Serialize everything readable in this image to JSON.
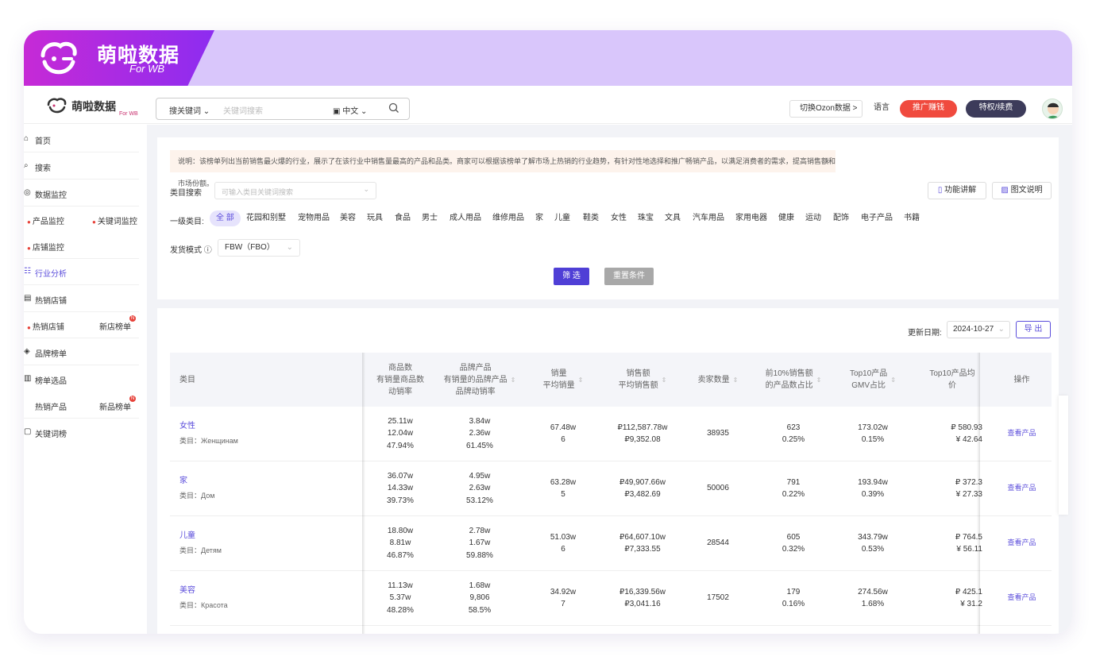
{
  "banner": {
    "brand": "萌啦数据",
    "sub": "For WB"
  },
  "topbar": {
    "logo_text": "萌啦数据",
    "logo_sub": "For WB",
    "search_type": "搜关键词",
    "search_placeholder": "关键词搜索",
    "search_lang": "中文",
    "switch_label": "切换Ozon数据 >",
    "language_label": "语言",
    "promo_label": "推广赚钱",
    "renew_label": "特权/续费"
  },
  "sidebar": {
    "items": [
      {
        "icon": "⌂",
        "label": "首页"
      },
      {
        "icon": "⌕",
        "label": "搜索"
      },
      {
        "icon": "◎",
        "label": "数据监控"
      },
      {
        "icon": "▣",
        "label": "店铺监控"
      },
      {
        "icon": "☷",
        "label": "行业分析"
      },
      {
        "icon": "▤",
        "label": "热销店铺"
      },
      {
        "icon": "◈",
        "label": "品牌榜单"
      },
      {
        "icon": "▥",
        "label": "榜单选品"
      },
      {
        "icon": "▢",
        "label": "关键词榜"
      }
    ],
    "sub": {
      "product_monitor": "产品监控",
      "keyword_monitor": "关键词监控",
      "store_monitor": "店铺监控",
      "hot_store": "热销店铺",
      "new_store_list": "新店榜单",
      "hot_product": "热销产品",
      "new_product_list": "新品榜单"
    }
  },
  "filter": {
    "notice": "说明：该榜单列出当前销售最火爆的行业，展示了在该行业中销售量最高的产品和品类。商家可以根据该榜单了解市场上热销的行业趋势，有针对性地选择和推广畅销产品，以满足消费者的需求，提高销售额和市场份额。",
    "notice_close": "×",
    "category_search_label": "类目搜索",
    "category_search_placeholder": "可输入类目关键词搜索",
    "feature_btn": "功能讲解",
    "guide_btn": "图文说明",
    "level1_label": "一级类目:",
    "categories": [
      "全 部",
      "花园和别墅",
      "宠物用品",
      "美容",
      "玩具",
      "食品",
      "男士",
      "成人用品",
      "维修用品",
      "家",
      "儿童",
      "鞋类",
      "女性",
      "珠宝",
      "文具",
      "汽车用品",
      "家用电器",
      "健康",
      "运动",
      "配饰",
      "电子产品",
      "书籍"
    ],
    "ship_label": "发货模式",
    "ship_value": "FBW（FBO）",
    "submit": "筛 选",
    "reset": "重置条件"
  },
  "table": {
    "update_label": "更新日期:",
    "update_date": "2024-10-27",
    "export": "导 出",
    "headers": {
      "category": "类目",
      "products": [
        "商品数",
        "有销量商品数",
        "动销率"
      ],
      "brand": [
        "品牌产品",
        "有销量的品牌产品",
        "品牌动销率"
      ],
      "sales": [
        "销量",
        "平均销量"
      ],
      "revenue": [
        "销售额",
        "平均销售额"
      ],
      "sellers": "卖家数量",
      "top10pct": [
        "前10%销售额",
        "的产品数占比"
      ],
      "top10gmv": [
        "Top10产品",
        "GMV占比"
      ],
      "top10price": [
        "Top10产品均",
        "价"
      ],
      "action": "操作"
    },
    "rows": [
      {
        "name": "女性",
        "ru": "类目：Женщинам",
        "products": [
          "25.11w",
          "12.04w",
          "47.94%"
        ],
        "brand": [
          "3.84w",
          "2.36w",
          "61.45%"
        ],
        "sales": [
          "67.48w",
          "6"
        ],
        "revenue": [
          "₽112,587.78w",
          "₽9,352.08"
        ],
        "sellers": "38935",
        "top10pct": [
          "623",
          "0.25%"
        ],
        "top10gmv": [
          "173.02w",
          "0.15%"
        ],
        "price": [
          "₽ 580.93",
          "¥ 42.64"
        ],
        "action": "查看产品"
      },
      {
        "name": "家",
        "ru": "类目：Дом",
        "products": [
          "36.07w",
          "14.33w",
          "39.73%"
        ],
        "brand": [
          "4.95w",
          "2.63w",
          "53.12%"
        ],
        "sales": [
          "63.28w",
          "5"
        ],
        "revenue": [
          "₽49,907.66w",
          "₽3,482.69"
        ],
        "sellers": "50006",
        "top10pct": [
          "791",
          "0.22%"
        ],
        "top10gmv": [
          "193.94w",
          "0.39%"
        ],
        "price": [
          "₽ 372.3",
          "¥ 27.33"
        ],
        "action": "查看产品"
      },
      {
        "name": "儿童",
        "ru": "类目：Детям",
        "products": [
          "18.80w",
          "8.81w",
          "46.87%"
        ],
        "brand": [
          "2.78w",
          "1.67w",
          "59.88%"
        ],
        "sales": [
          "51.03w",
          "6"
        ],
        "revenue": [
          "₽64,607.10w",
          "₽7,333.55"
        ],
        "sellers": "28544",
        "top10pct": [
          "605",
          "0.32%"
        ],
        "top10gmv": [
          "343.79w",
          "0.53%"
        ],
        "price": [
          "₽ 764.5",
          "¥ 56.11"
        ],
        "action": "查看产品"
      },
      {
        "name": "美容",
        "ru": "类目：Красота",
        "products": [
          "11.13w",
          "5.37w",
          "48.28%"
        ],
        "brand": [
          "1.68w",
          "9,806",
          "58.5%"
        ],
        "sales": [
          "34.92w",
          "7"
        ],
        "revenue": [
          "₽16,339.56w",
          "₽3,041.16"
        ],
        "sellers": "17502",
        "top10pct": [
          "179",
          "0.16%"
        ],
        "top10gmv": [
          "274.56w",
          "1.68%"
        ],
        "price": [
          "₽ 425.1",
          "¥ 31.2"
        ],
        "action": "查看产品"
      }
    ]
  },
  "colors": {
    "accent": "#5b4ddb",
    "banner": "#d9c6fb",
    "promo": "#f04a3e",
    "renew": "#3c3b5a"
  }
}
